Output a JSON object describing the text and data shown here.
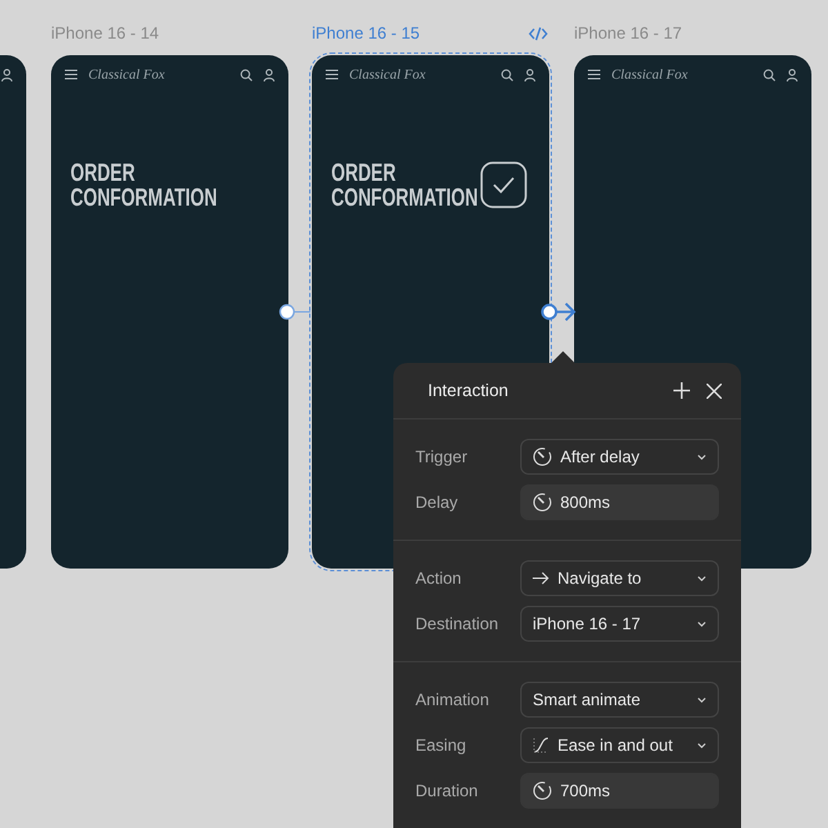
{
  "frames": [
    {
      "title": "iPhone 16 - 14",
      "selected": false,
      "brand": "Classical Fox",
      "heading": [
        "ORDER",
        "CONFORMATION"
      ]
    },
    {
      "title": "iPhone 16 - 15",
      "selected": true,
      "brand": "Classical Fox",
      "heading": [
        "ORDER",
        "CONFORMATION"
      ],
      "checkmark": true
    },
    {
      "title": "iPhone 16 - 17",
      "selected": false,
      "brand": "Classical Fox"
    }
  ],
  "panel": {
    "title": "Interaction",
    "sections": [
      [
        {
          "label": "Trigger",
          "kind": "select",
          "value": "After delay"
        },
        {
          "label": "Delay",
          "kind": "input",
          "value": "800ms"
        }
      ],
      [
        {
          "label": "Action",
          "kind": "select",
          "value": "Navigate to"
        },
        {
          "label": "Destination",
          "kind": "select",
          "value": "iPhone 16 - 17"
        }
      ],
      [
        {
          "label": "Animation",
          "kind": "select",
          "value": "Smart animate"
        },
        {
          "label": "Easing",
          "kind": "select",
          "value": "Ease in and out"
        },
        {
          "label": "Duration",
          "kind": "input",
          "value": "700ms"
        }
      ]
    ]
  }
}
